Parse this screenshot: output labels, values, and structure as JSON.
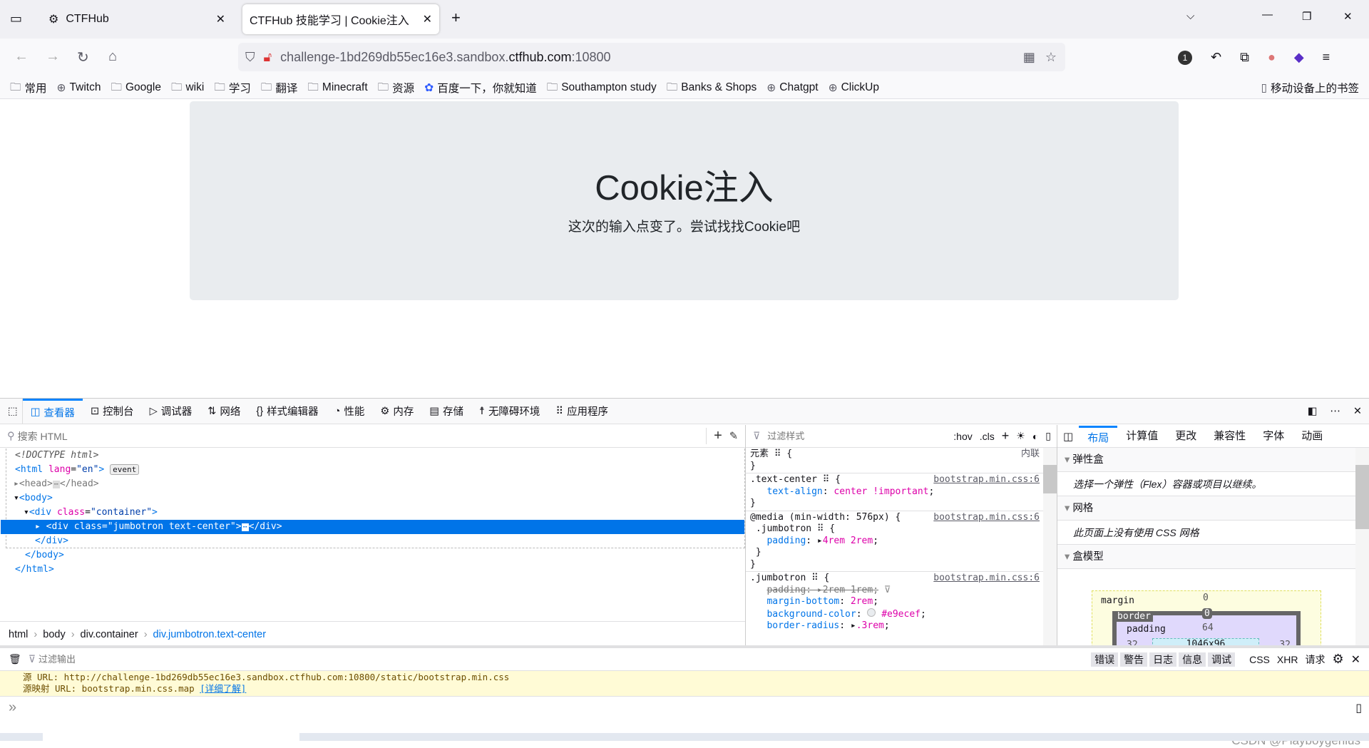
{
  "browser": {
    "tabs": [
      {
        "label": "CTFHub",
        "active": false
      },
      {
        "label": "CTFHub 技能学习 | Cookie注入",
        "active": true
      }
    ],
    "url": {
      "prefix": "challenge-1bd269db55ec16e3.sandbox.",
      "domain": "ctfhub.com",
      "suffix": ":10800"
    },
    "extension_badge": "1",
    "bookmarks": [
      "常用",
      "Twitch",
      "Google",
      "wiki",
      "学习",
      "翻译",
      "Minecraft",
      "资源",
      "百度一下，你就知道",
      "Southampton study",
      "Banks & Shops",
      "Chatgpt",
      "ClickUp"
    ],
    "mobile_bookmarks": "移动设备上的书签"
  },
  "page": {
    "title": "Cookie注入",
    "subtitle": "这次的输入点变了。尝试找找Cookie吧",
    "jumbotron_color": "#e9ecef"
  },
  "devtools": {
    "tools": [
      "查看器",
      "控制台",
      "调试器",
      "网络",
      "样式编辑器",
      "性能",
      "内存",
      "存储",
      "无障碍环境",
      "应用程序"
    ],
    "search_placeholder": "搜索 HTML",
    "tree": {
      "doctype": "<!DOCTYPE html>",
      "html_open": "<html",
      "lang_attr": "lang",
      "lang_val": "\"en\"",
      "event": "event",
      "head": "<head>",
      "head_close": "</head>",
      "body": "<body>",
      "div_container": "<div",
      "class_attr": "class",
      "container_val": "\"container\"",
      "jumbo": "<div class=\"jumbotron text-center\">",
      "div_close": "</div>",
      "body_close": "</body>",
      "html_close": "</html>",
      "ellipsis": "⋯",
      "gt": ">",
      "eq": "="
    },
    "breadcrumb": [
      "html",
      "body",
      "div.container",
      "div.jumbotron.text-center"
    ],
    "styles": {
      "filter_placeholder": "过滤样式",
      "hov": ":hov",
      "cls": ".cls",
      "element": "元素",
      "inline": "内联",
      "rules": [
        {
          "selector": ".text-center",
          "source": "bootstrap.min.css:6",
          "decls": [
            {
              "prop": "text-align",
              "value": "center !important"
            }
          ]
        },
        {
          "media": "@media (min-width: 576px) {",
          "selector": ".jumbotron",
          "source": "bootstrap.min.css:6",
          "decls": [
            {
              "prop": "padding",
              "value": "4rem 2rem"
            }
          ]
        },
        {
          "selector": ".jumbotron",
          "source": "bootstrap.min.css:6",
          "decls": [
            {
              "prop": "padding",
              "value": "2rem 1rem",
              "overridden": true
            },
            {
              "prop": "margin-bottom",
              "value": "2rem"
            },
            {
              "prop": "background-color",
              "value": "#e9ecef"
            },
            {
              "prop": "border-radius",
              "value": ".3rem"
            }
          ]
        }
      ]
    },
    "layout": {
      "tabs": [
        "布局",
        "计算值",
        "更改",
        "兼容性",
        "字体",
        "动画"
      ],
      "flex_title": "弹性盒",
      "flex_msg": "选择一个弹性（Flex）容器或项目以继续。",
      "grid_title": "网格",
      "grid_msg": "此页面上没有使用 CSS 网格",
      "box_title": "盒模型",
      "box": {
        "margin_label": "margin",
        "margin": "0",
        "border_label": "border",
        "border": "0",
        "padding_label": "padding",
        "padding": "64",
        "content": "1046x96",
        "side_padding": "32"
      }
    },
    "console": {
      "filter_placeholder": "过滤输出",
      "filters": [
        "错误",
        "警告",
        "日志",
        "信息",
        "调试"
      ],
      "extra": [
        "CSS",
        "XHR",
        "请求"
      ],
      "messages": [
        {
          "label": "源 URL:",
          "text": "http://challenge-1bd269db55ec16e3.sandbox.ctfhub.com:10800/static/bootstrap.min.css"
        },
        {
          "label": "源映射 URL:",
          "text": "bootstrap.min.css.map",
          "link": "[详细了解]"
        }
      ],
      "prompt": "»"
    }
  },
  "watermark": "CSDN @Playboygenius"
}
